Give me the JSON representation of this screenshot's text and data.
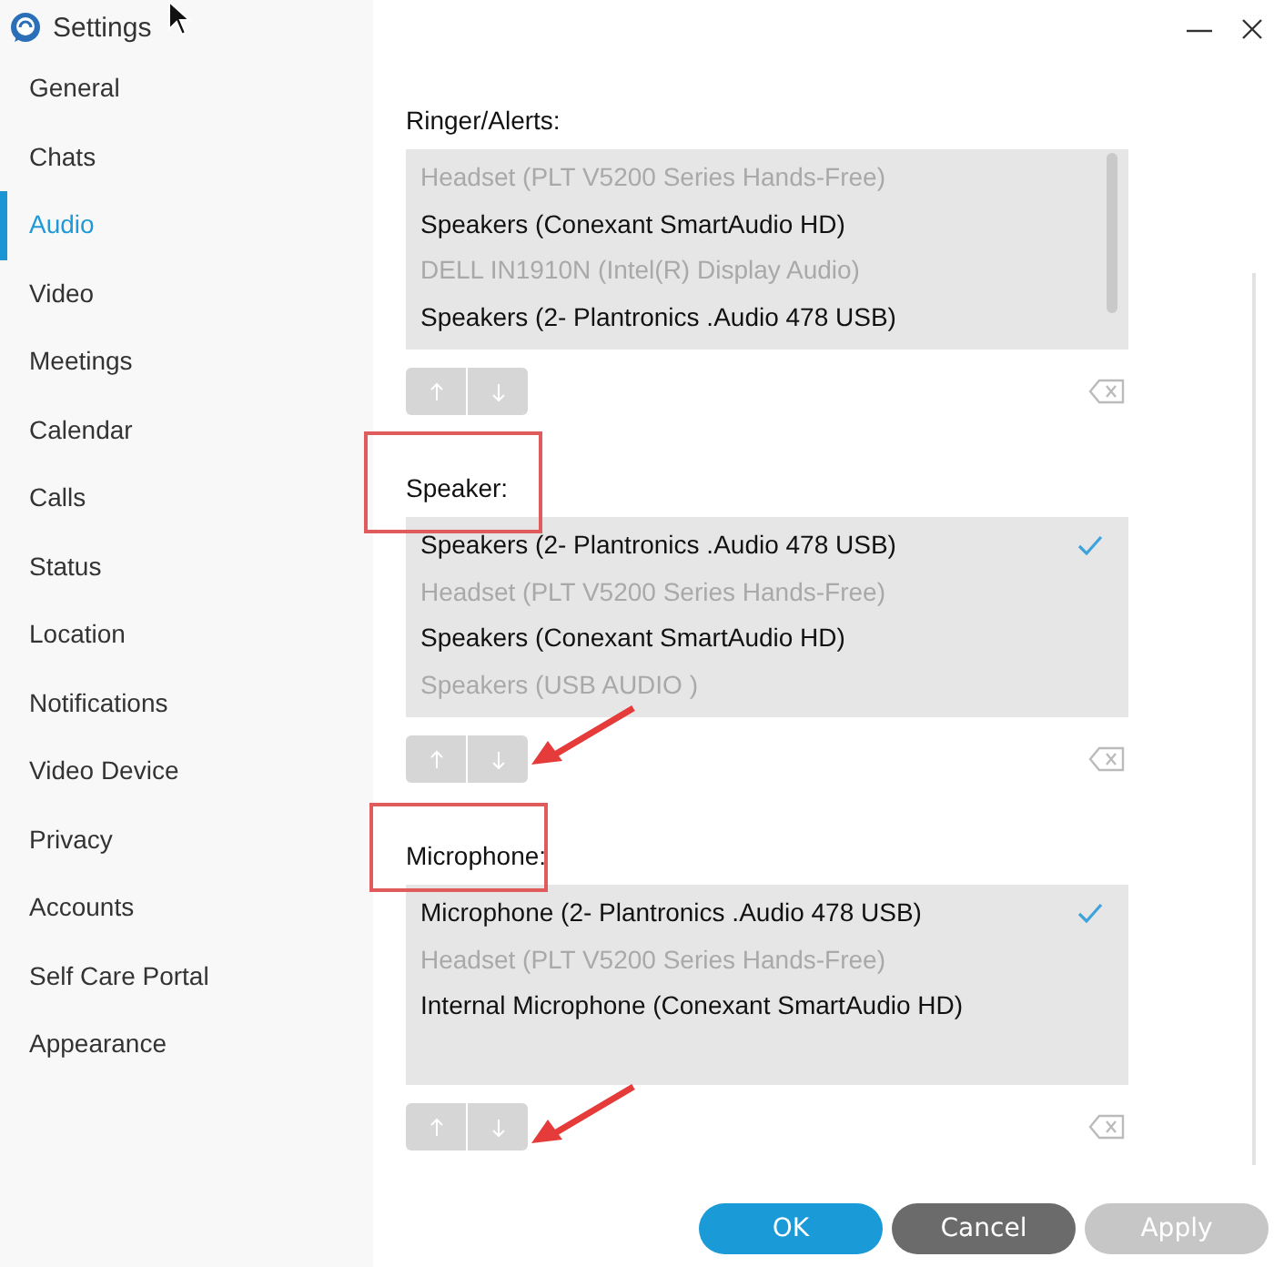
{
  "window": {
    "title": "Settings"
  },
  "sidebar": {
    "items": [
      {
        "label": "General",
        "selected": false
      },
      {
        "label": "Chats",
        "selected": false
      },
      {
        "label": "Audio",
        "selected": true
      },
      {
        "label": "Video",
        "selected": false
      },
      {
        "label": "Meetings",
        "selected": false
      },
      {
        "label": "Calendar",
        "selected": false
      },
      {
        "label": "Calls",
        "selected": false
      },
      {
        "label": "Status",
        "selected": false
      },
      {
        "label": "Location",
        "selected": false
      },
      {
        "label": "Notifications",
        "selected": false
      },
      {
        "label": "Video Device",
        "selected": false
      },
      {
        "label": "Privacy",
        "selected": false
      },
      {
        "label": "Accounts",
        "selected": false
      },
      {
        "label": "Self Care Portal",
        "selected": false
      },
      {
        "label": "Appearance",
        "selected": false
      }
    ]
  },
  "sections": [
    {
      "label": "Ringer/Alerts:",
      "scrollable": true,
      "devices": [
        {
          "name": "Headset (PLT V5200 Series Hands-Free)",
          "disabled": true,
          "selected": false
        },
        {
          "name": "Speakers (Conexant SmartAudio HD)",
          "disabled": false,
          "selected": false
        },
        {
          "name": "DELL IN1910N (Intel(R) Display Audio)",
          "disabled": true,
          "selected": false
        },
        {
          "name": "Speakers (2- Plantronics .Audio 478 USB)",
          "disabled": false,
          "selected": false
        }
      ]
    },
    {
      "label": "Speaker:",
      "scrollable": false,
      "devices": [
        {
          "name": "Speakers (2- Plantronics .Audio 478 USB)",
          "disabled": false,
          "selected": true
        },
        {
          "name": "Headset (PLT V5200 Series Hands-Free)",
          "disabled": true,
          "selected": false
        },
        {
          "name": "Speakers (Conexant SmartAudio HD)",
          "disabled": false,
          "selected": false
        },
        {
          "name": "Speakers (USB  AUDIO  )",
          "disabled": true,
          "selected": false
        }
      ]
    },
    {
      "label": "Microphone:",
      "scrollable": false,
      "devices": [
        {
          "name": "Microphone (2- Plantronics .Audio 478 USB)",
          "disabled": false,
          "selected": true
        },
        {
          "name": "Headset (PLT V5200 Series Hands-Free)",
          "disabled": true,
          "selected": false
        },
        {
          "name": "Internal Microphone (Conexant SmartAudio HD)",
          "disabled": false,
          "selected": false
        }
      ]
    }
  ],
  "buttons": [
    {
      "label": "OK",
      "kind": "primary"
    },
    {
      "label": "Cancel",
      "kind": "secondary"
    },
    {
      "label": "Apply",
      "kind": "disabled"
    }
  ]
}
